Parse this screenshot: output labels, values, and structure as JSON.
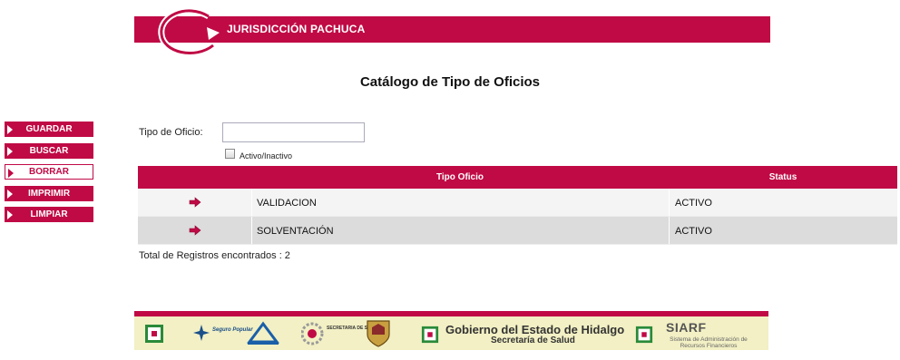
{
  "header": {
    "title": "JURISDICCIÓN PACHUCA"
  },
  "page": {
    "title": "Catálogo de Tipo de Oficios"
  },
  "sidebar": {
    "buttons": [
      {
        "label": "GUARDAR"
      },
      {
        "label": "BUSCAR"
      },
      {
        "label": "BORRAR"
      },
      {
        "label": "IMPRIMIR"
      },
      {
        "label": "LIMPIAR"
      }
    ]
  },
  "form": {
    "tipo_label": "Tipo de Oficio:",
    "tipo_value": "",
    "checkbox_label": "Activo/Inactivo",
    "checkbox_checked": false
  },
  "grid": {
    "columns": [
      "",
      "Tipo Oficio",
      "Status"
    ],
    "rows": [
      {
        "tipo": "VALIDACION",
        "status": "ACTIVO"
      },
      {
        "tipo": "SOLVENTACIÓN",
        "status": "ACTIVO"
      }
    ]
  },
  "total": "Total de Registros encontrados : 2",
  "footer": {
    "seguro_popular": "Seguro Popular",
    "secretaria_label": "SECRETARIA DE SALUD",
    "gobierno_title": "Gobierno del Estado de Hidalgo",
    "gobierno_sub": "Secretaría de Salud",
    "siarf_title": "SIARF",
    "siarf_sub": "Sistema de Administración de Recursos Financieros"
  },
  "colors": {
    "brand": "#c00a45",
    "footer_bg": "#f2f0c4"
  }
}
